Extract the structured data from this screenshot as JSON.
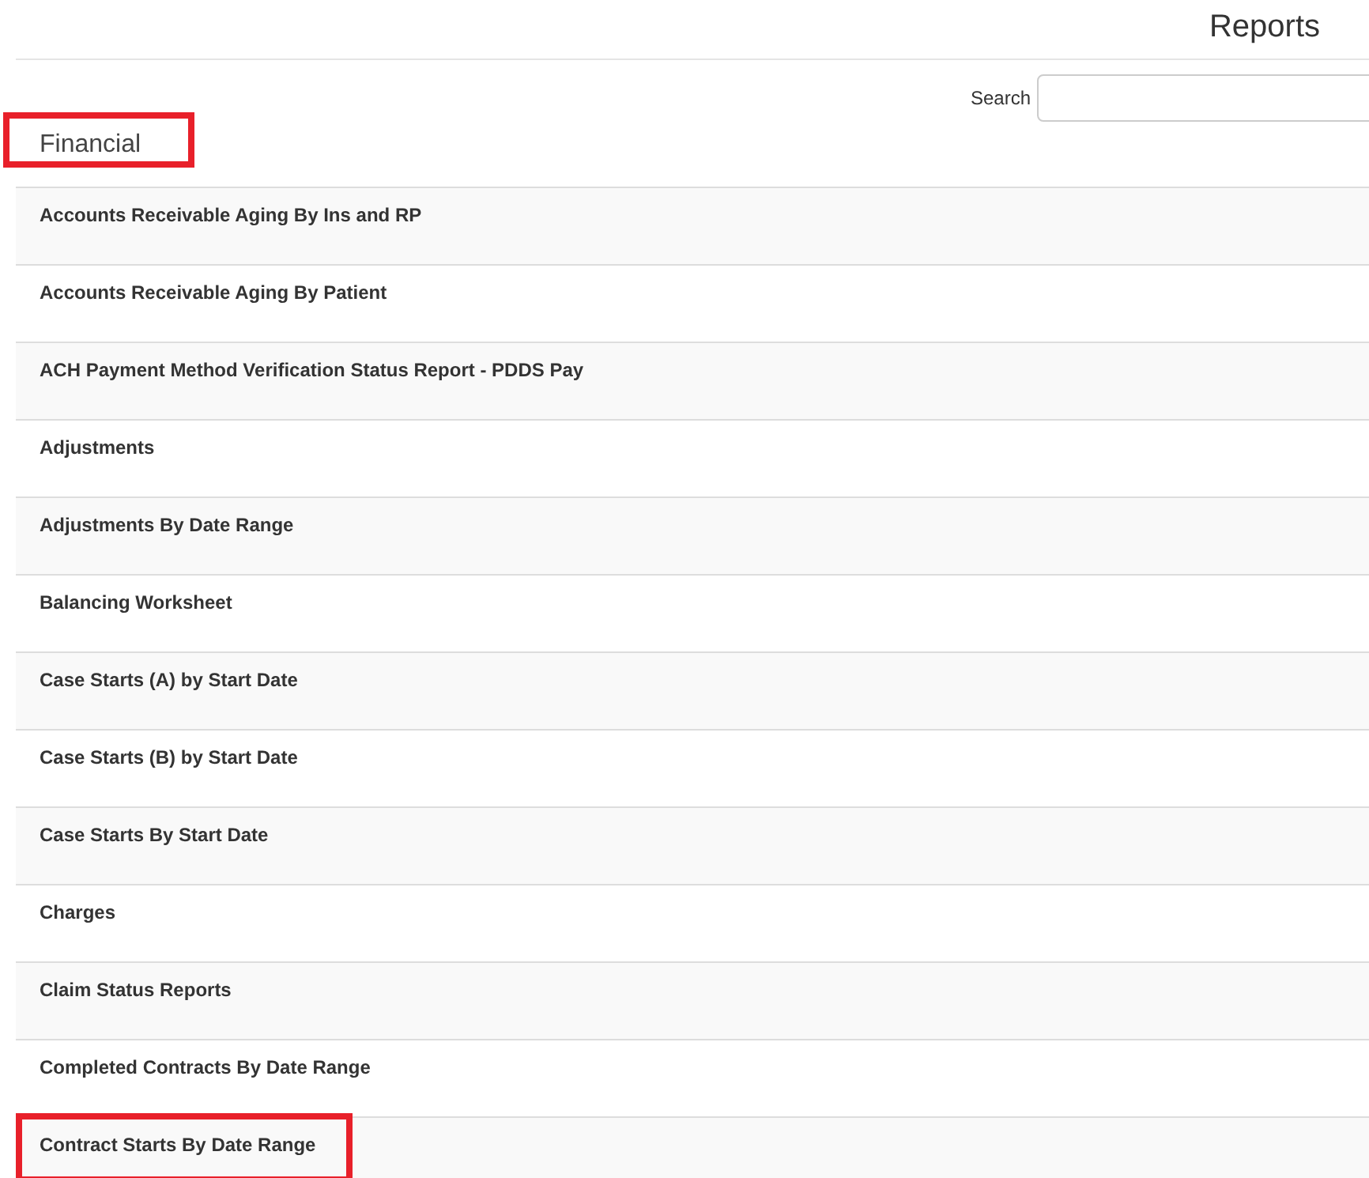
{
  "page": {
    "title": "Reports"
  },
  "search": {
    "label": "Search"
  },
  "section": {
    "title": "Financial",
    "highlighted": true
  },
  "reports": [
    {
      "name": "Accounts Receivable Aging By Ins and RP",
      "highlighted": false
    },
    {
      "name": "Accounts Receivable Aging By Patient",
      "highlighted": false
    },
    {
      "name": "ACH Payment Method Verification Status Report - PDDS Pay",
      "highlighted": false
    },
    {
      "name": "Adjustments",
      "highlighted": false
    },
    {
      "name": "Adjustments By Date Range",
      "highlighted": false
    },
    {
      "name": "Balancing Worksheet",
      "highlighted": false
    },
    {
      "name": "Case Starts (A) by Start Date",
      "highlighted": false
    },
    {
      "name": "Case Starts (B) by Start Date",
      "highlighted": false
    },
    {
      "name": "Case Starts By Start Date",
      "highlighted": false
    },
    {
      "name": "Charges",
      "highlighted": false
    },
    {
      "name": "Claim Status Reports",
      "highlighted": false
    },
    {
      "name": "Completed Contracts By Date Range",
      "highlighted": false
    },
    {
      "name": "Contract Starts By Date Range",
      "highlighted": true
    }
  ]
}
